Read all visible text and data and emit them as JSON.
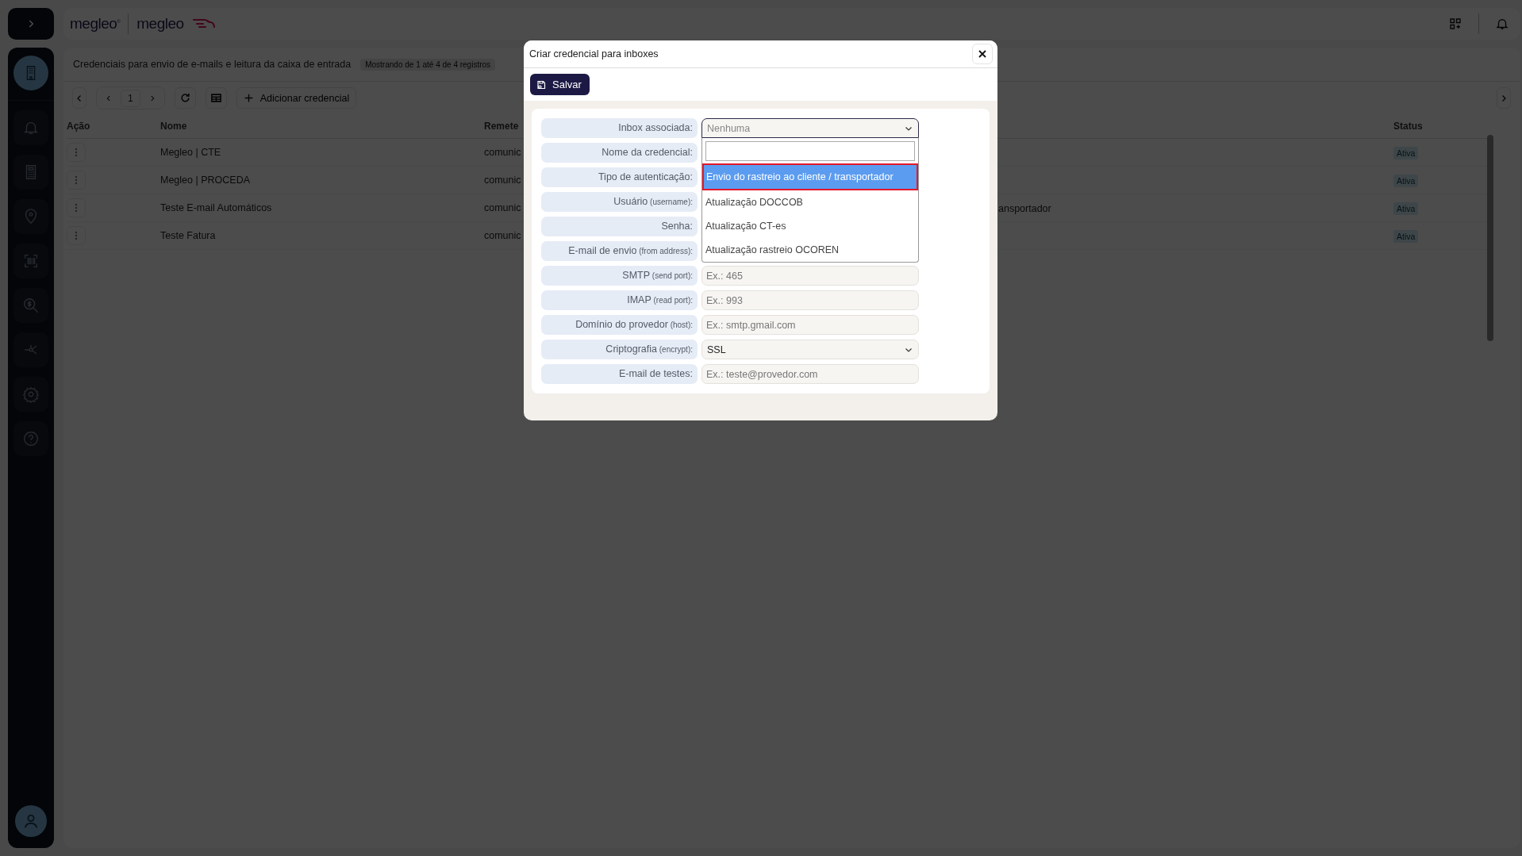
{
  "sidebar": {
    "items": [
      {
        "selected": true
      },
      {
        "selected": false
      },
      {
        "selected": false
      },
      {
        "selected": false
      },
      {
        "selected": false
      },
      {
        "selected": false
      },
      {
        "selected": false
      },
      {
        "selected": false
      },
      {
        "selected": false
      }
    ]
  },
  "header": {
    "brand": "megleo",
    "registered": "®",
    "product": "megleo"
  },
  "page": {
    "title": "Credenciais para envio de e-mails e leitura da caixa de entrada",
    "count": "Mostrando de 1 até 4 de 4 registros"
  },
  "toolbar": {
    "page": "1",
    "add_label": "Adicionar credencial"
  },
  "table": {
    "columns": [
      "Ação",
      "Nome",
      "Remete",
      "Status"
    ],
    "rows": [
      {
        "name": "Megleo | CTE",
        "sender": "comunic",
        "status": "Ativa"
      },
      {
        "name": "Megleo | PROCEDA",
        "sender": "comunic",
        "status": "Ativa"
      },
      {
        "name": "Teste E-mail Automáticos",
        "sender": "comunic",
        "column_4": "ansportador",
        "status": "Ativa"
      },
      {
        "name": "Teste Fatura",
        "sender": "comunic",
        "status": "Ativa"
      }
    ]
  },
  "modal": {
    "title": "Criar credencial para inboxes",
    "save_label": "Salvar",
    "fields": [
      {
        "label": "Inbox associada:",
        "control": {
          "kind": "select",
          "placeholder": "Nenhuma",
          "open": true,
          "options": [
            {
              "label": "Envio do rastreio ao cliente / transportador",
              "selected": true
            },
            {
              "label": "Atualização DOCCOB",
              "selected": false
            },
            {
              "label": "Atualização CT-es",
              "selected": false
            },
            {
              "label": "Atualização rastreio OCOREN",
              "selected": false
            }
          ]
        }
      },
      {
        "label": "Nome da credencial:"
      },
      {
        "label": "Tipo de autenticação:"
      },
      {
        "label": "Usuário",
        "hint": "(username):"
      },
      {
        "label": "Senha:"
      },
      {
        "label": "E-mail de envio",
        "hint": "(from address):"
      },
      {
        "label": "SMTP",
        "hint": "(send port):",
        "control": {
          "kind": "input",
          "placeholder": "Ex.: 465"
        }
      },
      {
        "label": "IMAP",
        "hint": "(read port):",
        "control": {
          "kind": "input",
          "placeholder": "Ex.: 993"
        }
      },
      {
        "label": "Domínio do provedor",
        "hint": "(host):",
        "control": {
          "kind": "input",
          "placeholder": "Ex.: smtp.gmail.com"
        }
      },
      {
        "label": "Criptografia",
        "hint": "(encrypt):",
        "control": {
          "kind": "select",
          "value": "SSL",
          "open": false
        }
      },
      {
        "label": "E-mail de testes:",
        "control": {
          "kind": "input",
          "placeholder": "Ex.: teste@provedor.com"
        }
      }
    ]
  }
}
